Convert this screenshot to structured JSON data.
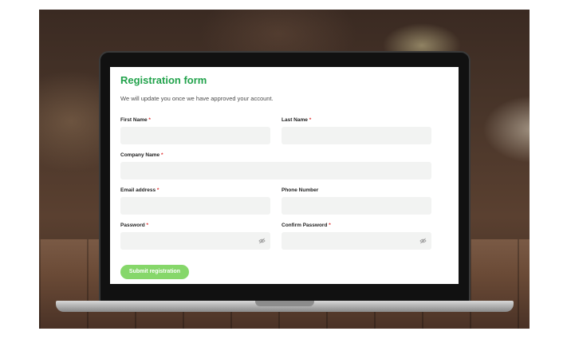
{
  "form": {
    "title": "Registration form",
    "subtitle": "We will update you once we have approved your account.",
    "required_mark": "*",
    "fields": {
      "first_name": {
        "label": "First Name",
        "required": true,
        "value": ""
      },
      "last_name": {
        "label": "Last Name",
        "required": true,
        "value": ""
      },
      "company_name": {
        "label": "Company Name",
        "required": true,
        "value": ""
      },
      "email": {
        "label": "Email address",
        "required": true,
        "value": ""
      },
      "phone": {
        "label": "Phone Number",
        "required": false,
        "value": ""
      },
      "password": {
        "label": "Password",
        "required": true,
        "value": "",
        "icon": "eye-off-icon"
      },
      "confirm_password": {
        "label": "Confirm Password",
        "required": true,
        "value": "",
        "icon": "eye-off-icon"
      }
    },
    "submit_label": "Submit registration"
  },
  "colors": {
    "title": "#21a24b",
    "required": "#e03030",
    "input_bg": "#f2f3f2",
    "button_bg": "#86d76a"
  }
}
